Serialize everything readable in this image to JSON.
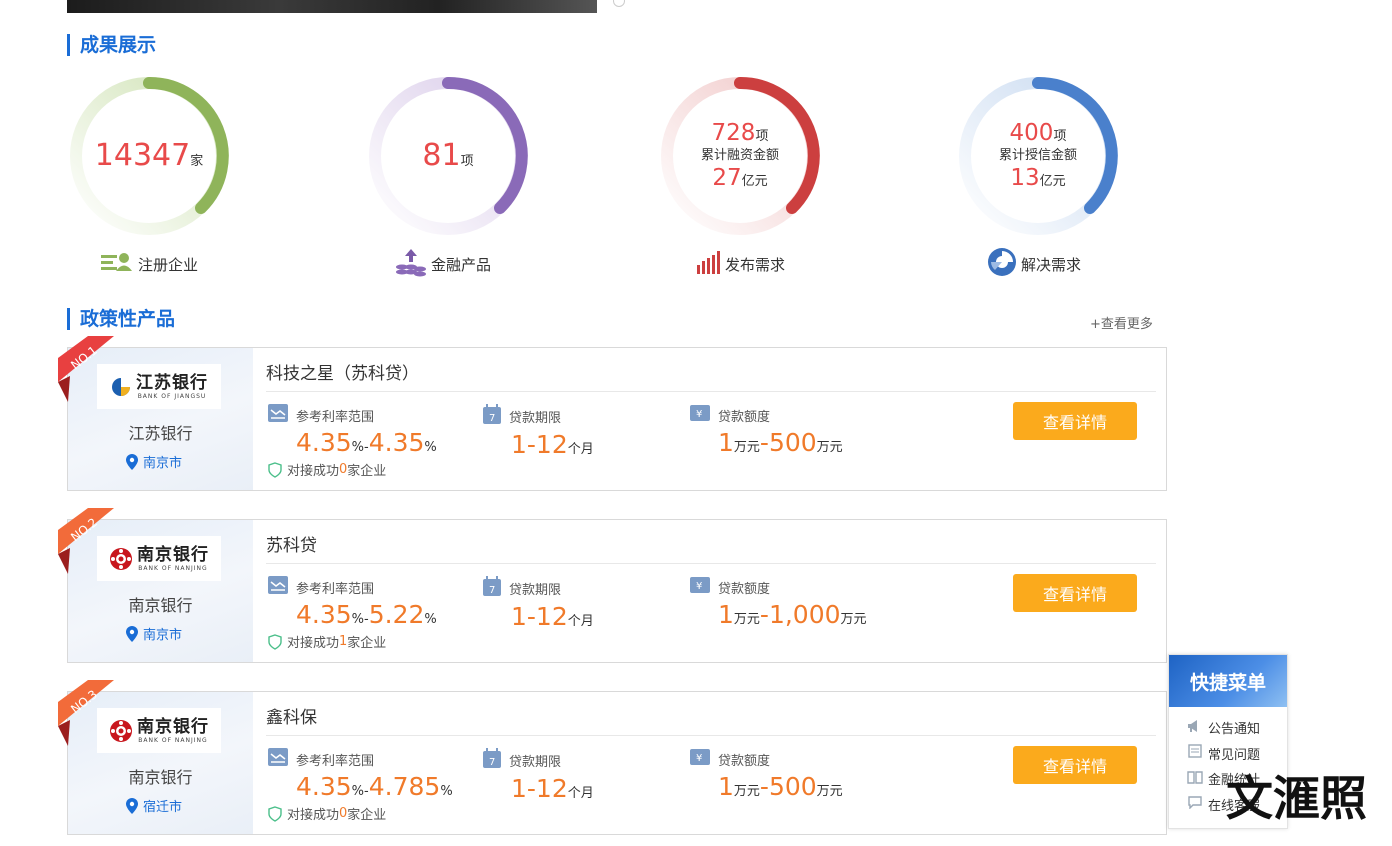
{
  "section_results": {
    "title": "成果展示"
  },
  "stats": [
    {
      "big": "14347",
      "unit": "家",
      "label": "注册企业",
      "color": "#8fb45a",
      "light": "#e6f0d6",
      "icon": "enterprise-icon"
    },
    {
      "big": "81",
      "unit": "项",
      "label": "金融产品",
      "color": "#8a6ab8",
      "light": "#e9e2f2",
      "icon": "money-stack-icon"
    },
    {
      "line1": "728",
      "unit1": "项",
      "sub": "累计融资金额",
      "line2": "27",
      "unit2": "亿元",
      "label": "发布需求",
      "color": "#cc3f3f",
      "light": "#f6dddd",
      "icon": "bar-chart-icon"
    },
    {
      "line1": "400",
      "unit1": "项",
      "sub": "累计授信金额",
      "line2": "13",
      "unit2": "亿元",
      "label": "解决需求",
      "color": "#4a80cc",
      "light": "#dde8f6",
      "icon": "pie-chart-icon"
    }
  ],
  "section_policy": {
    "title": "政策性产品",
    "more": "+查看更多"
  },
  "labels": {
    "rate": "参考利率范围",
    "term": "贷款期限",
    "amount": "贷款额度",
    "match_prefix": "对接成功",
    "match_suffix": "家企业",
    "detail": "查看详情",
    "pct": "%",
    "dash": "-",
    "month": "个月",
    "wan": "万元"
  },
  "products": [
    {
      "rank": "NO.1",
      "bank": "江苏银行",
      "city": "南京市",
      "logo": "jiangsu-bank-logo",
      "title": "科技之星（苏科贷）",
      "rate_min": "4.35",
      "rate_max": "4.35",
      "term": "1-12",
      "amt_min": "1",
      "amt_max": "500",
      "matched": "0"
    },
    {
      "rank": "NO.2",
      "bank": "南京银行",
      "city": "南京市",
      "logo": "nanjing-bank-logo",
      "title": "苏科贷",
      "rate_min": "4.35",
      "rate_max": "5.22",
      "term": "1-12",
      "amt_min": "1",
      "amt_max": "1,000",
      "matched": "1"
    },
    {
      "rank": "NO.3",
      "bank": "南京银行",
      "city": "宿迁市",
      "logo": "nanjing-bank-logo",
      "title": "鑫科保",
      "rate_min": "4.35",
      "rate_max": "4.785",
      "term": "1-12",
      "amt_min": "1",
      "amt_max": "500",
      "matched": "0"
    }
  ],
  "logos": {
    "jiangsu": {
      "cn": "江苏银行",
      "en": "BANK OF JIANGSU"
    },
    "nanjing": {
      "cn": "南京银行",
      "en": "BANK OF NANJING"
    }
  },
  "quick_menu": {
    "title": "快捷菜单",
    "items": [
      {
        "label": "公告通知",
        "icon": "megaphone-icon"
      },
      {
        "label": "常见问题",
        "icon": "document-icon"
      },
      {
        "label": "金融统计",
        "icon": "book-icon"
      },
      {
        "label": "在线客服",
        "icon": "chat-icon"
      }
    ]
  },
  "watermark": "文滙照"
}
